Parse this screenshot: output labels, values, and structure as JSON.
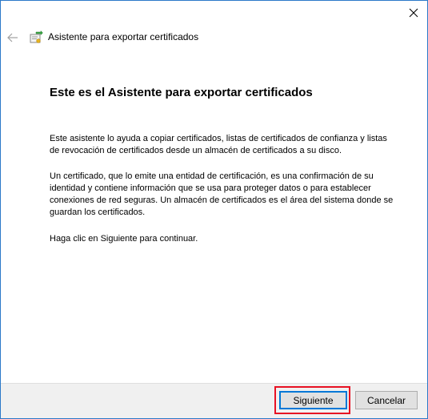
{
  "window": {
    "title": "Asistente para exportar certificados"
  },
  "content": {
    "heading": "Este es el Asistente para exportar certificados",
    "paragraph1": "Este asistente lo ayuda a copiar certificados, listas de certificados de confianza y listas de revocación de certificados desde un almacén de certificados a su disco.",
    "paragraph2": "Un certificado, que lo emite una entidad de certificación, es una confirmación de su identidad y contiene información que se usa para proteger datos o para establecer conexiones de red seguras. Un almacén de certificados es el área del sistema donde se guardan los certificados.",
    "paragraph3": "Haga clic en Siguiente para continuar."
  },
  "footer": {
    "next_label": "Siguiente",
    "cancel_label": "Cancelar"
  },
  "colors": {
    "accent": "#0078d7",
    "highlight_box": "#e81123",
    "footer_bg": "#f0f0f0"
  },
  "icons": {
    "close": "close-icon",
    "back": "back-arrow-icon",
    "certificate": "certificate-icon"
  }
}
